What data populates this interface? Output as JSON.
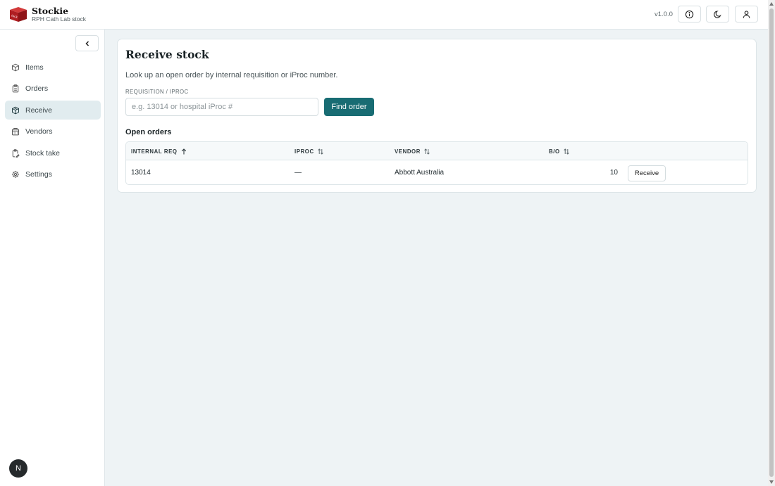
{
  "app": {
    "name": "Stockie",
    "subtitle": "RPH Cath Lab stock",
    "version": "v1.0.0",
    "accent": "#186c73",
    "header_buttons": [
      "info-icon",
      "moon-icon",
      "user-icon"
    ]
  },
  "sidebar": {
    "collapse_icon": "chevron-left-icon",
    "items": [
      {
        "label": "Items",
        "icon": "box-icon"
      },
      {
        "label": "Orders",
        "icon": "clipboard-icon"
      },
      {
        "label": "Receive",
        "icon": "package-icon",
        "active": true
      },
      {
        "label": "Vendors",
        "icon": "building-icon"
      },
      {
        "label": "Stock take",
        "icon": "clipboard-edit-icon"
      },
      {
        "label": "Settings",
        "icon": "gear-icon"
      }
    ],
    "avatar_initial": "N"
  },
  "page": {
    "title": "Receive stock",
    "description": "Look up an open order by internal requisition or iProc number.",
    "field_label": "REQUISITION / IPROC",
    "search_placeholder": "e.g. 13014 or hospital iProc #",
    "search_value": "",
    "find_button": "Find order"
  },
  "open_orders": {
    "title": "Open orders",
    "columns": [
      {
        "label": "INTERNAL REQ",
        "sort": "ascending"
      },
      {
        "label": "IPROC",
        "sort": "none"
      },
      {
        "label": "VENDOR",
        "sort": "none"
      },
      {
        "label": "B/O",
        "sort": "none"
      }
    ],
    "rows": [
      {
        "internal_req": "13014",
        "iproc": "—",
        "vendor": "Abbott Australia",
        "bo": "10",
        "action": "Receive"
      }
    ]
  }
}
